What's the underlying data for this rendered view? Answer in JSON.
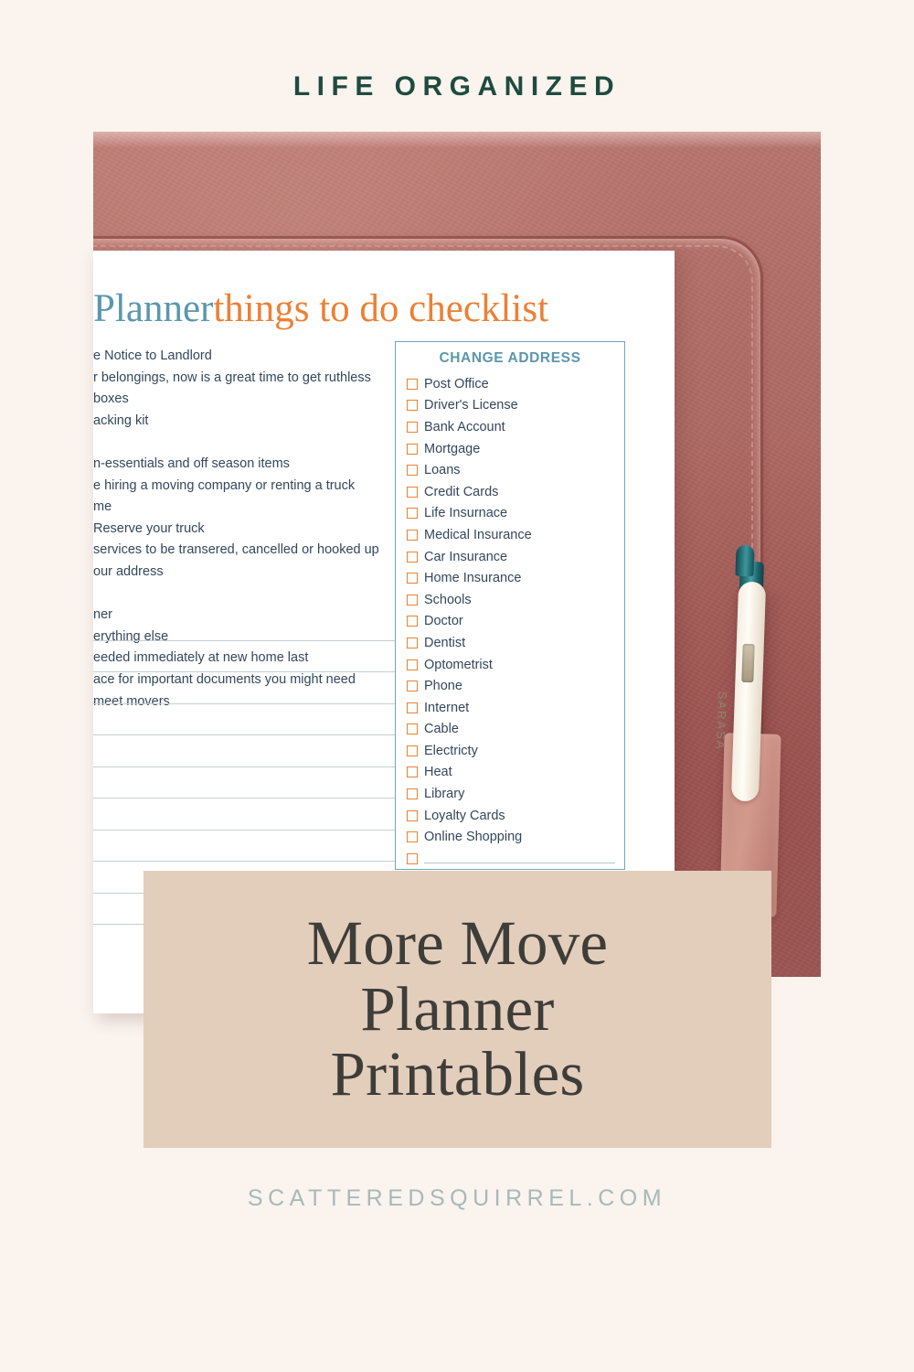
{
  "brand": {
    "eyebrow": "LIFE ORGANIZED",
    "footer_url": "SCATTEREDSQUIRREL.COM",
    "accent_green": "#1f4b3f",
    "accent_teal": "#5b97ad",
    "accent_orange": "#ec8035",
    "overlay_bg": "#e3cdbb",
    "page_bg": "#faf3ee",
    "text_dark": "#3d3d39"
  },
  "overlay": {
    "line1": "More Move",
    "line2": "Planner",
    "line3": "Printables"
  },
  "printable": {
    "title_blue": "Planner",
    "title_orange": "things to do checklist",
    "todo_items": [
      "e Notice to Landlord",
      "r belongings, now is a great time to get ruthless",
      "boxes",
      "acking kit",
      "",
      "n-essentials and off season items",
      "e hiring a moving company or renting a truck",
      "me",
      "Reserve your truck",
      "services to be transered, cancelled or hooked up",
      "our address",
      "",
      "ner",
      "erything else",
      "eeded immediately at new home last",
      "ace for important documents you might need",
      "meet movers"
    ],
    "write_line_count": 10,
    "panel": {
      "title": "CHANGE ADDRESS",
      "items": [
        "Post Office",
        "Driver's License",
        "Bank Account",
        "Mortgage",
        "Loans",
        "Credit Cards",
        "Life Insurnace",
        "Medical Insurance",
        "Car Insurance",
        "Home Insurance",
        "Schools",
        "Doctor",
        "Dentist",
        "Optometrist",
        "Phone",
        "Internet",
        "Cable",
        "Electricty",
        "Heat",
        "Library",
        "Loyalty Cards",
        "Online Shopping"
      ],
      "blank_rows": 2
    }
  },
  "photo": {
    "pen_brand": "SARASA"
  }
}
